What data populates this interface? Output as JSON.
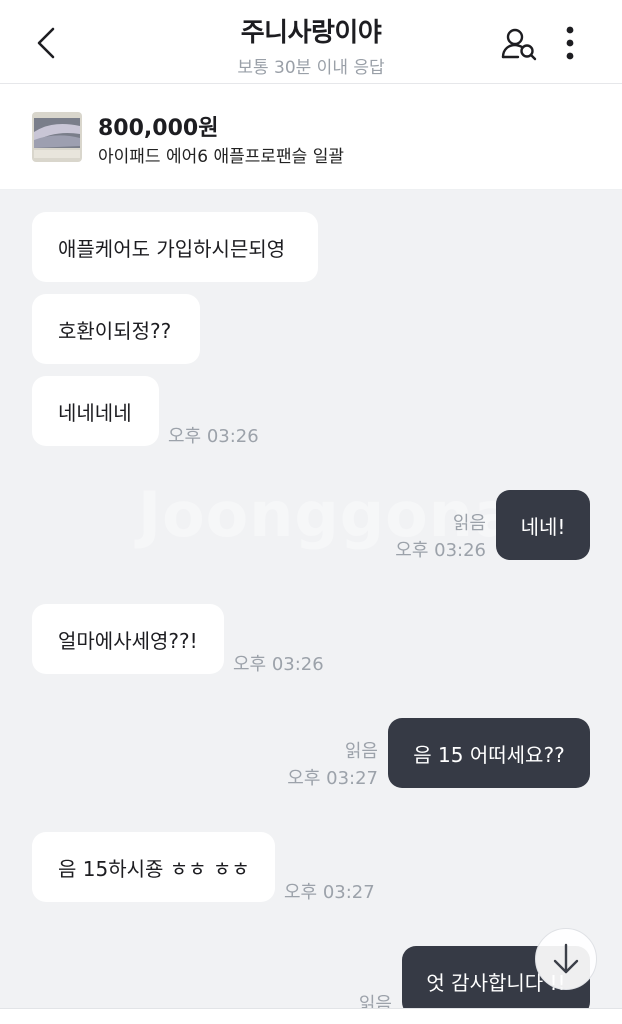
{
  "header": {
    "title": "주니사랑이야",
    "subtitle": "보통 30분 이내 응답",
    "icons": {
      "back": "chevron-left-icon",
      "user_search": "user-search-icon",
      "more": "more-vertical-icon"
    }
  },
  "product": {
    "price": "800,000원",
    "name": "아이패드 에어6 애플프로팬슬 일괄"
  },
  "watermark": "Joonggonara",
  "messages": [
    {
      "side": "in",
      "text": "애플케어도 가입하시믄되영",
      "time": ""
    },
    {
      "side": "in",
      "text": "호환이되정??",
      "time": ""
    },
    {
      "side": "in",
      "text": "네네네네",
      "time": "오후 03:26"
    },
    {
      "side": "out",
      "text": "네네!",
      "read": "읽음",
      "time": "오후 03:26"
    },
    {
      "side": "in",
      "text": "얼마에사세영??!",
      "time": "오후 03:26"
    },
    {
      "side": "out",
      "text": "음 15 어떠세요??",
      "read": "읽음",
      "time": "오후 03:27"
    },
    {
      "side": "in",
      "text": "음 15하시죵 ㅎㅎ ㅎㅎ",
      "time": "오후 03:27"
    },
    {
      "side": "out",
      "text": "엇 감사합니다 !!",
      "read": "읽음",
      "time": ""
    }
  ],
  "colors": {
    "chat_bg": "#f1f2f4",
    "incoming_bubble": "#ffffff",
    "outgoing_bubble": "#363a45",
    "meta_text": "#9ca2aa"
  }
}
